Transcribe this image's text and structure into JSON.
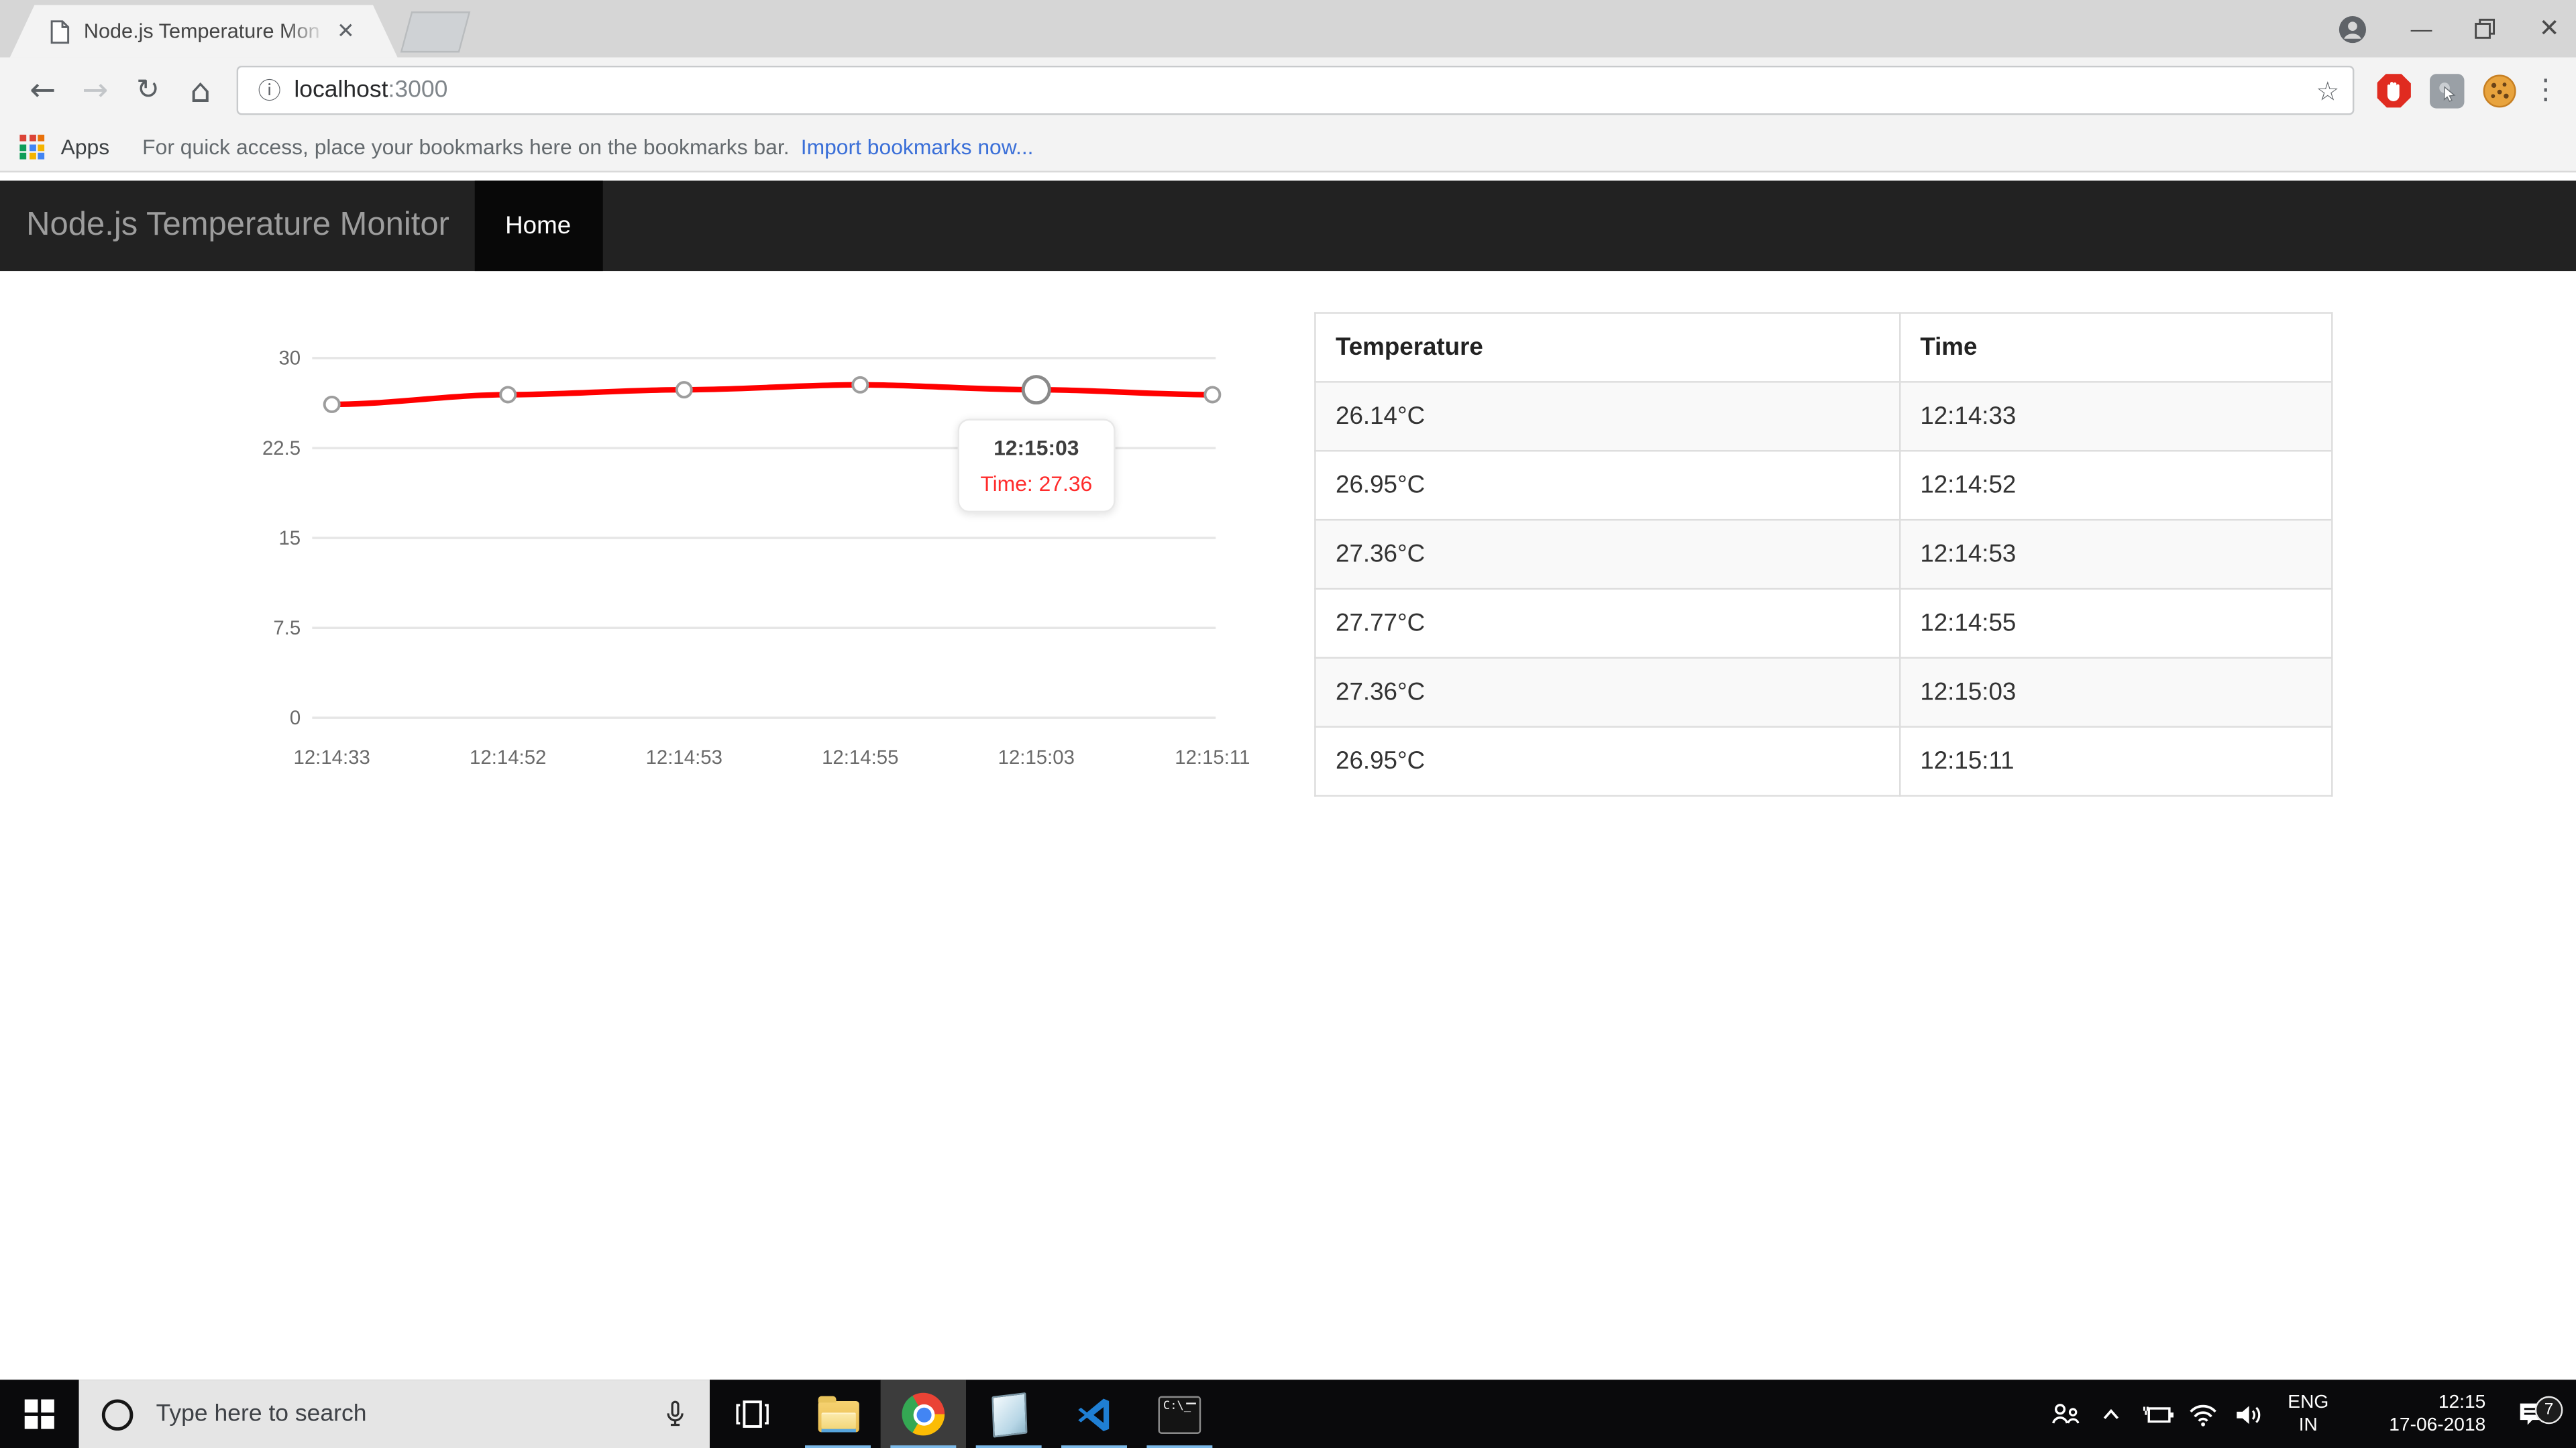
{
  "browser": {
    "tab_title": "Node.js Temperature Mon",
    "url_host": "localhost",
    "url_port": ":3000",
    "bookmarks": {
      "apps_label": "Apps",
      "hint": "For quick access, place your bookmarks here on the bookmarks bar.",
      "import_link": "Import bookmarks now..."
    }
  },
  "app": {
    "brand": "Node.js Temperature Monitor",
    "nav_home": "Home",
    "table": {
      "headers": [
        "Temperature",
        "Time"
      ],
      "rows": [
        [
          "26.14°C",
          "12:14:33"
        ],
        [
          "26.95°C",
          "12:14:52"
        ],
        [
          "27.36°C",
          "12:14:53"
        ],
        [
          "27.77°C",
          "12:14:55"
        ],
        [
          "27.36°C",
          "12:15:03"
        ],
        [
          "26.95°C",
          "12:15:11"
        ]
      ]
    }
  },
  "chart_data": {
    "type": "line",
    "title": "",
    "x": [
      "12:14:33",
      "12:14:52",
      "12:14:53",
      "12:14:55",
      "12:15:03",
      "12:15:11"
    ],
    "series": [
      {
        "name": "Time",
        "color": "#ff0000",
        "values": [
          26.14,
          26.95,
          27.36,
          27.77,
          27.36,
          26.95
        ]
      }
    ],
    "ylim": [
      0,
      30
    ],
    "yticks": [
      0,
      7.5,
      15,
      22.5,
      30
    ],
    "grid": true,
    "legend": "none",
    "hover_index": 4,
    "tooltip": {
      "title": "12:15:03",
      "label": "Time: 27.36"
    }
  },
  "taskbar": {
    "search_placeholder": "Type here to search",
    "tray": {
      "lang1": "ENG",
      "lang2": "IN",
      "time": "12:15",
      "date": "17-06-2018",
      "badge": "7"
    }
  },
  "colors": {
    "chart_line": "#ff0000",
    "tooltip_value": "#ff2b2b",
    "link_blue": "#3a6fd8",
    "navbar_bg": "#222222",
    "nav_active_bg": "#080808",
    "taskbar_indicator": "#7cb9e8"
  }
}
